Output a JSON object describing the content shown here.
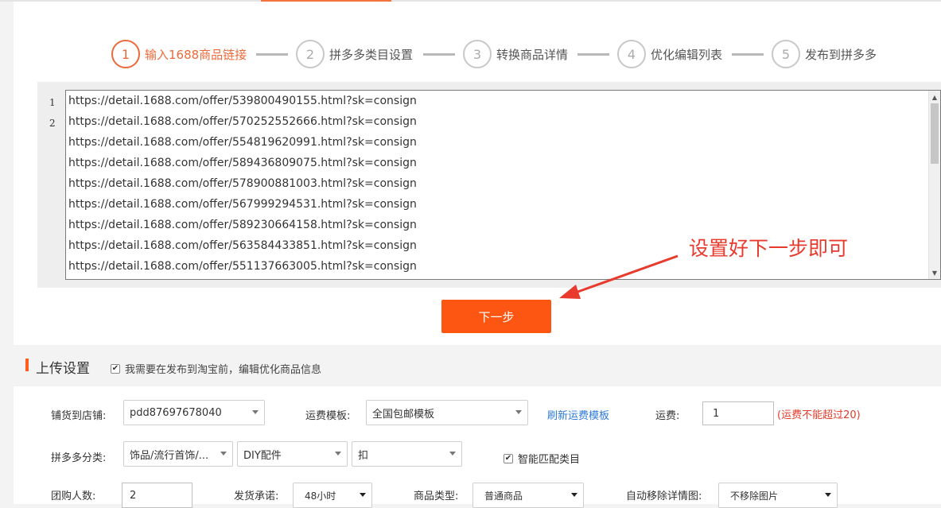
{
  "steps": [
    {
      "num": "1",
      "label": "输入1688商品链接"
    },
    {
      "num": "2",
      "label": "拼多多类目设置"
    },
    {
      "num": "3",
      "label": "转换商品详情"
    },
    {
      "num": "4",
      "label": "优化编辑列表"
    },
    {
      "num": "5",
      "label": "发布到拼多多"
    }
  ],
  "editor": {
    "line_numbers": [
      "1",
      "2"
    ],
    "lines": [
      "https://detail.1688.com/offer/539800490155.html?sk=consign",
      "https://detail.1688.com/offer/570252552666.html?sk=consign",
      "https://detail.1688.com/offer/554819620991.html?sk=consign",
      "https://detail.1688.com/offer/589436809075.html?sk=consign",
      "https://detail.1688.com/offer/578900881003.html?sk=consign",
      "https://detail.1688.com/offer/567999294531.html?sk=consign",
      "https://detail.1688.com/offer/589230664158.html?sk=consign",
      "https://detail.1688.com/offer/563584433851.html?sk=consign",
      "https://detail.1688.com/offer/551137663005.html?sk=consign"
    ]
  },
  "annotation": {
    "text": "设置好下一步即可",
    "color": "#e83a2d"
  },
  "next_button": {
    "label": "下一步",
    "color": "#fd5612"
  },
  "upload": {
    "title": "上传设置",
    "checkbox_label": "我需要在发布到淘宝前，编辑优化商品信息",
    "checkbox_checked": true
  },
  "settings": {
    "shop_label": "铺货到店铺:",
    "shop_value": "pdd87697678040",
    "freight_template_label": "运费模板:",
    "freight_template_value": "全国包邮模板",
    "refresh_link": "刷新运费模板",
    "freight_label": "运费:",
    "freight_value": "1",
    "freight_warning": "(运费不能超过20)",
    "category_label": "拼多多分类:",
    "category_1": "饰品/流行首饰/...",
    "category_2": "DIY配件",
    "category_3": "扣",
    "smart_match_label": "智能匹配类目",
    "smart_match_checked": true,
    "group_size_label": "团购人数:",
    "group_size_value": "2",
    "ship_promise_label": "发货承诺:",
    "ship_promise_value": "48小时",
    "product_type_label": "商品类型:",
    "product_type_value": "普通商品",
    "auto_remove_label": "自动移除详情图:",
    "auto_remove_value": "不移除图片"
  },
  "colors": {
    "accent": "#ec6a3a",
    "link": "#2c7ad6",
    "warning": "#e13c2a"
  }
}
